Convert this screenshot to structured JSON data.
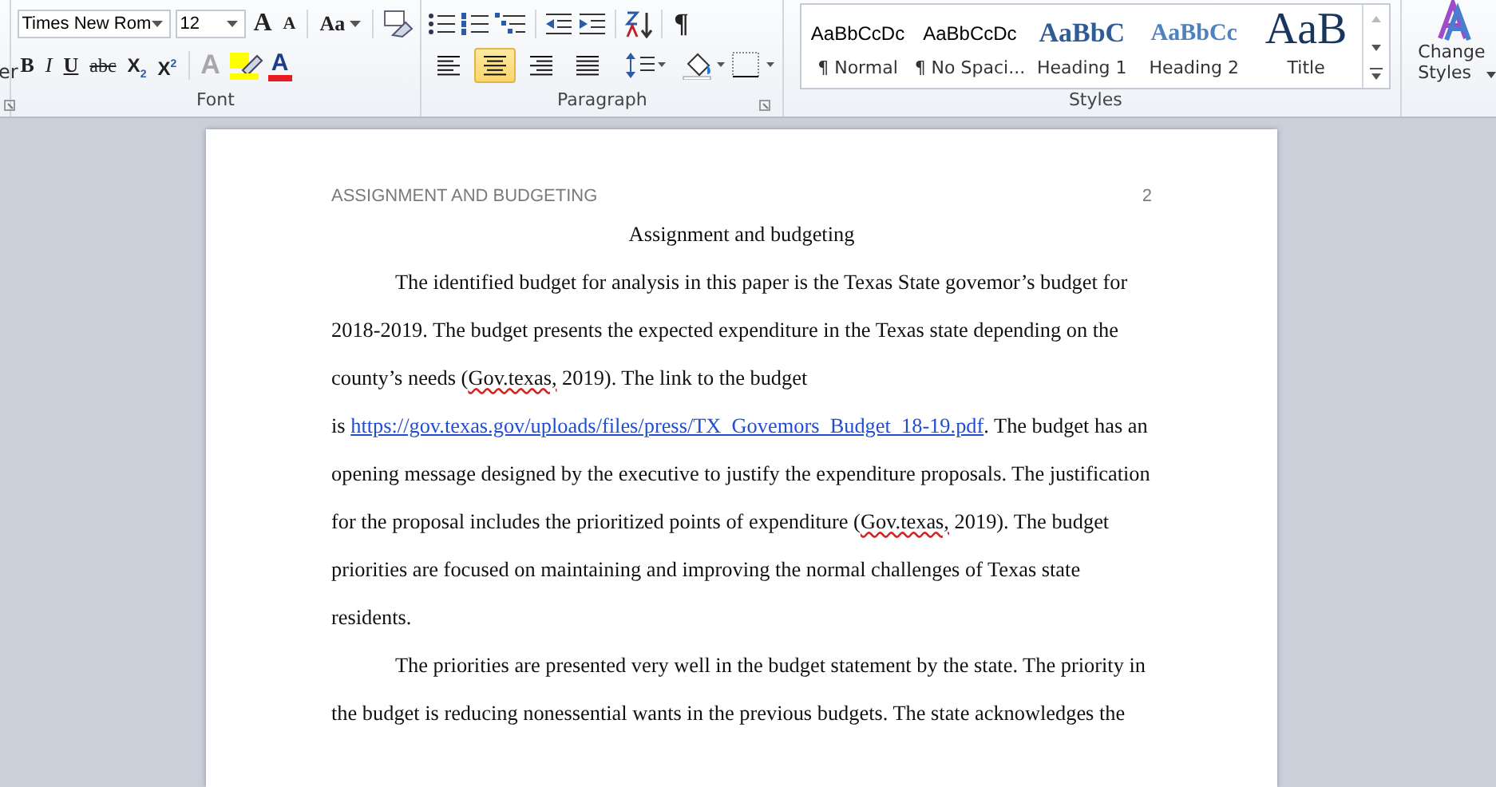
{
  "ribbon": {
    "clipboard_fragment": "er",
    "font": {
      "label": "Font",
      "font_name": "Times New Rom",
      "font_size": "12",
      "grow": "A",
      "shrink": "A",
      "change_case": "Aa",
      "format_buttons": [
        {
          "label": "B",
          "kind": "bold"
        },
        {
          "label": "I",
          "kind": "italic"
        },
        {
          "label": "U",
          "kind": "underline"
        },
        {
          "label": "abc",
          "kind": "strike"
        },
        {
          "label": "X$_{2}$",
          "kind": "sub"
        },
        {
          "label": "X$^{2}$",
          "kind": "sup"
        }
      ],
      "effects": "A",
      "font_color": "A"
    },
    "paragraph": {
      "label": "Paragraph",
      "pilcrow": "¶",
      "alignments": [
        {
          "kind": "left",
          "selected": false
        },
        {
          "kind": "center",
          "selected": true
        },
        {
          "kind": "right",
          "selected": false
        },
        {
          "kind": "justify",
          "selected": false
        }
      ]
    },
    "styles": {
      "label": "Styles",
      "items": [
        {
          "preview": "AaBbCcDc",
          "name": "¶ Normal",
          "kind": "normal"
        },
        {
          "preview": "AaBbCcDc",
          "name": "¶ No Spaci...",
          "kind": "normal"
        },
        {
          "preview": "AaBbC",
          "name": "Heading 1",
          "kind": "h1"
        },
        {
          "preview": "AaBbCc",
          "name": "Heading 2",
          "kind": "h2"
        },
        {
          "preview": "AaB",
          "name": "Title",
          "kind": "title"
        }
      ],
      "change_styles": [
        "Change",
        "Styles"
      ]
    }
  },
  "document": {
    "header": "ASSIGNMENT AND BUDGETING",
    "page_number": "2",
    "title": "Assignment and budgeting",
    "lines": [
      {
        "indent": true,
        "parts": [
          {
            "text": "The identified budget for analysis in this paper is the Texas State govemor’s budget for"
          }
        ]
      },
      {
        "indent": false,
        "parts": [
          {
            "text": "2018-2019. The budget presents the expected expenditure in the Texas state depending on the"
          }
        ]
      },
      {
        "indent": false,
        "parts": [
          {
            "text": "county’s needs ("
          },
          {
            "text": "Gov.texas,",
            "kind": "misspelled"
          },
          {
            "text": " 2019). The link  to the budget"
          }
        ]
      },
      {
        "indent": false,
        "parts": [
          {
            "text": "is "
          },
          {
            "text": "https://gov.texas.gov/uploads/files/press/TX_Govemors_Budget_18-19.pdf",
            "kind": "link"
          },
          {
            "text": ". The budget has an"
          }
        ]
      },
      {
        "indent": false,
        "parts": [
          {
            "text": "opening message designed by the executive to justify the expenditure proposals. The justification"
          }
        ]
      },
      {
        "indent": false,
        "parts": [
          {
            "text": "for the proposal includes the prioritized points of expenditure ("
          },
          {
            "text": "Gov.texas,",
            "kind": "misspelled"
          },
          {
            "text": " 2019). The budget"
          }
        ]
      },
      {
        "indent": false,
        "parts": [
          {
            "text": "priorities  are focused on maintaining and improving the normal challenges of Texas state"
          }
        ]
      },
      {
        "indent": false,
        "parts": [
          {
            "text": "residents."
          }
        ]
      },
      {
        "indent": true,
        "parts": [
          {
            "text": "The priorities  are presented very well in the budget statement by the state. The priority in"
          }
        ]
      },
      {
        "indent": false,
        "parts": [
          {
            "text": "the budget is reducing nonessential wants in the previous budgets. The state acknowledges the"
          }
        ]
      }
    ]
  }
}
